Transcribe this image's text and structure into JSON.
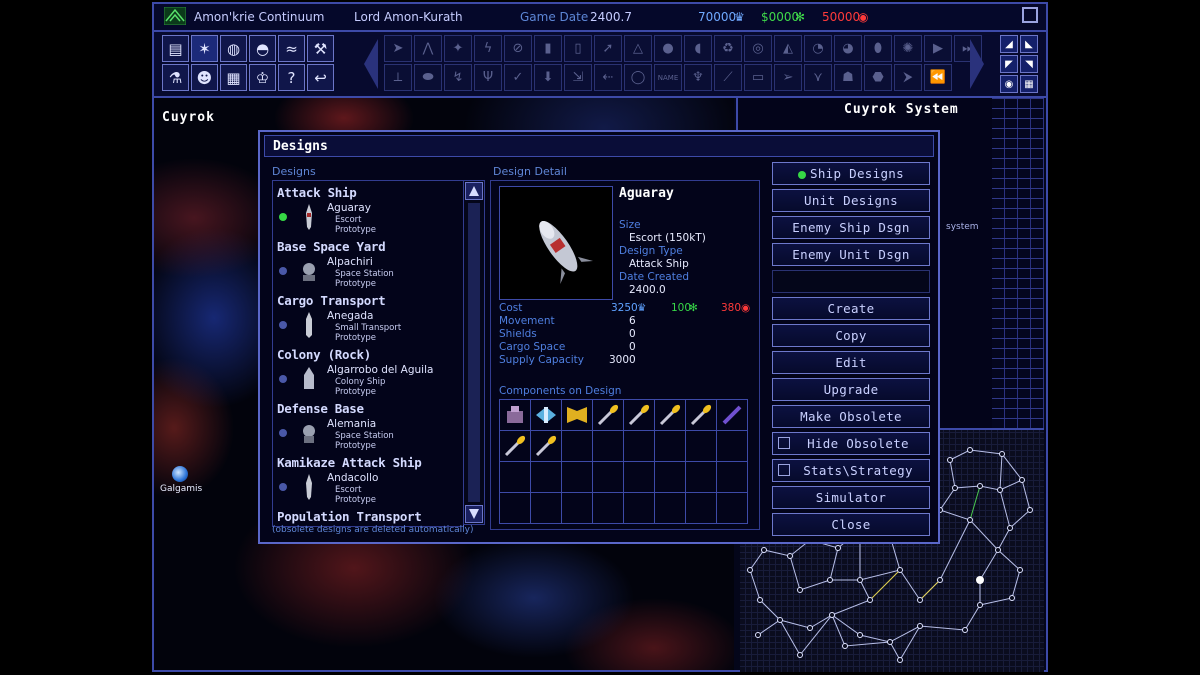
{
  "topbar": {
    "empire": "Amon'krie Continuum",
    "player": "Lord Amon-Kurath",
    "date_label": "Game Date",
    "date_value": "2400.7",
    "minerals": "70000",
    "organics": "$0000",
    "radioactives": "50000"
  },
  "map": {
    "region_title": "Cuyrok",
    "system_title": "Cuyrok System",
    "planet_label": "Galgamis",
    "system_side_label": "system"
  },
  "dialog": {
    "title": "Designs",
    "list_label": "Designs",
    "detail_label": "Design Detail",
    "footnote": "(obsolete designs are deleted automatically)",
    "designs": [
      {
        "category": "Attack Ship",
        "name": "Aguaray",
        "type": "Escort",
        "status": "Prototype",
        "selected": true
      },
      {
        "category": "Base Space Yard",
        "name": "Alpachiri",
        "type": "Space Station",
        "status": "Prototype",
        "selected": false
      },
      {
        "category": "Cargo Transport",
        "name": "Anegada",
        "type": "Small Transport",
        "status": "Prototype",
        "selected": false
      },
      {
        "category": "Colony (Rock)",
        "name": "Algarrobo del Aguila",
        "type": "Colony Ship",
        "status": "Prototype",
        "selected": false
      },
      {
        "category": "Defense Base",
        "name": "Alemania",
        "type": "Space Station",
        "status": "Prototype",
        "selected": false
      },
      {
        "category": "Kamikaze Attack Ship",
        "name": "Andacollo",
        "type": "Escort",
        "status": "Prototype",
        "selected": false
      },
      {
        "category": "Population Transport",
        "name": "",
        "type": "",
        "status": "",
        "selected": false
      }
    ],
    "detail": {
      "name": "Aguaray",
      "size_label": "Size",
      "size_value": "Escort (150kT)",
      "type_label": "Design Type",
      "type_value": "Attack Ship",
      "created_label": "Date Created",
      "created_value": "2400.0",
      "cost_label": "Cost",
      "cost_minerals": "3250",
      "cost_organics": "100",
      "cost_radioactives": "380",
      "movement_label": "Movement",
      "movement_value": "6",
      "shields_label": "Shields",
      "shields_value": "0",
      "cargo_label": "Cargo Space",
      "cargo_value": "0",
      "supply_label": "Supply Capacity",
      "supply_value": "3000",
      "components_label": "Components on Design"
    },
    "buttons": {
      "ship_designs": "Ship Designs",
      "unit_designs": "Unit Designs",
      "enemy_ship": "Enemy Ship Dsgn",
      "enemy_unit": "Enemy Unit Dsgn",
      "create": "Create",
      "copy": "Copy",
      "edit": "Edit",
      "upgrade": "Upgrade",
      "make_obsolete": "Make Obsolete",
      "hide_obsolete": "Hide Obsolete",
      "stats_strategy": "Stats\\Strategy",
      "simulator": "Simulator",
      "close": "Close"
    }
  },
  "colors": {
    "accent": "#3d4aa8",
    "minerals": "#5fa2ff",
    "organics": "#37d848",
    "radioactives": "#ff3a3a"
  }
}
